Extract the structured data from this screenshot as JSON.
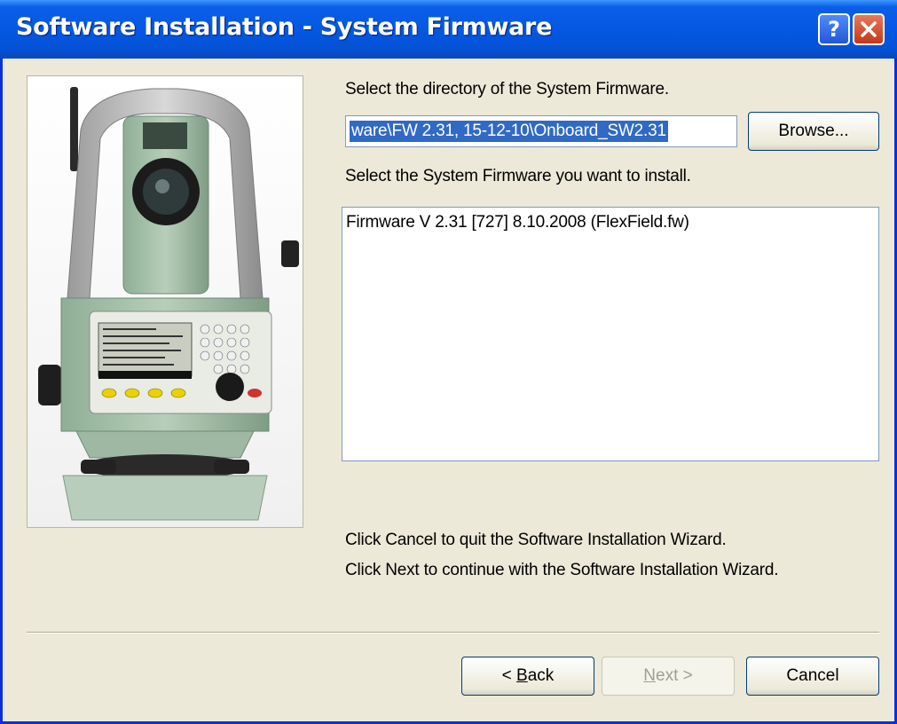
{
  "window": {
    "title": "Software Installation - System Firmware",
    "help_glyph": "?",
    "close_glyph": "×"
  },
  "wizard": {
    "dir_prompt": "Select the directory of the System Firmware.",
    "dir_value": "ware\\FW 2.31, 15-12-10\\Onboard_SW2.31",
    "browse_label": "Browse...",
    "select_prompt": "Select the System Firmware you want to install.",
    "firmware_items": [
      "Firmware V 2.31 [727] 8.10.2008 (FlexField.fw)"
    ],
    "info_cancel": "Click Cancel to quit the Software Installation Wizard.",
    "info_next": "Click Next to continue with the Software Installation Wizard."
  },
  "buttons": {
    "back_prefix": "< ",
    "back_accel": "B",
    "back_rest": "ack",
    "next_accel": "N",
    "next_rest": "ext >",
    "cancel": "Cancel"
  },
  "icons": {
    "help": "help-icon",
    "close": "close-icon",
    "photo": "total-station-photo"
  }
}
